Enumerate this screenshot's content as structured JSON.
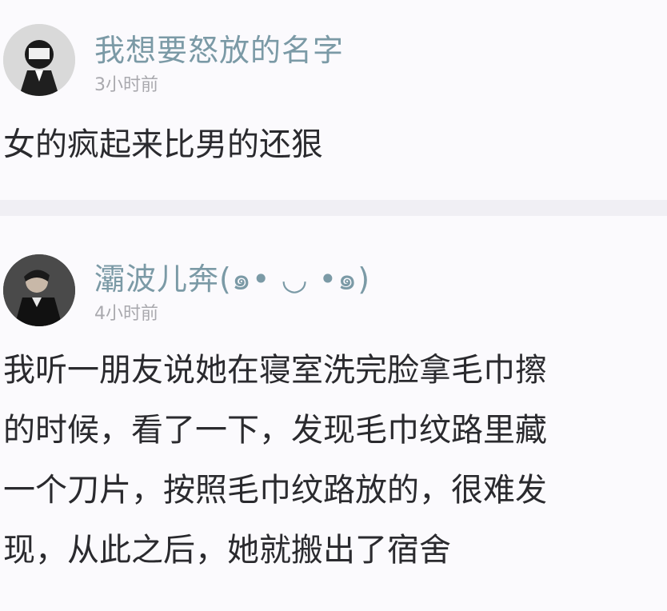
{
  "comments": [
    {
      "username": "我想要怒放的名字",
      "time": "3小时前",
      "text": "女的疯起来比男的还狠"
    },
    {
      "username": "灞波儿奔(๑• ◡ •๑)",
      "time": "4小时前",
      "lines": [
        "我听一朋友说她在寝室洗完脸拿毛巾擦",
        "的时候，看了一下，发现毛巾纹路里藏",
        "一个刀片，按照毛巾纹路放的，很难发",
        "现，从此之后，她就搬出了宿舍"
      ]
    }
  ]
}
